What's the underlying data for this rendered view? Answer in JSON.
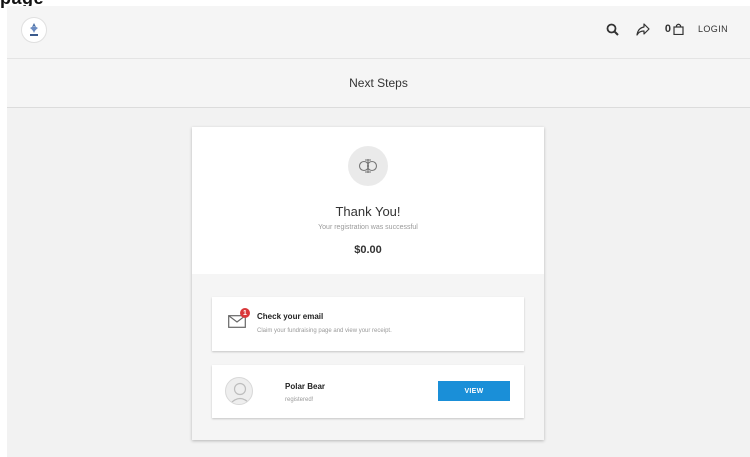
{
  "page": {
    "cut_title": "page",
    "title": "Next Steps"
  },
  "header": {
    "icons": [
      "search-icon",
      "share-icon",
      "bag-icon"
    ],
    "cart_count": "0",
    "login_label": "LOGIN"
  },
  "confirmation": {
    "heading": "Thank You!",
    "subtext": "Your registration was successful",
    "amount": "$0.00"
  },
  "email_panel": {
    "notification_count": "1",
    "title": "Check your email",
    "description": "Claim your fundraising page and view your receipt."
  },
  "participant": {
    "name": "Polar Bear",
    "status": "registered!",
    "button_label": "VIEW"
  },
  "colors": {
    "accent": "#1a8fd8",
    "notification": "#d9383a",
    "background": "#f2f2f2"
  }
}
